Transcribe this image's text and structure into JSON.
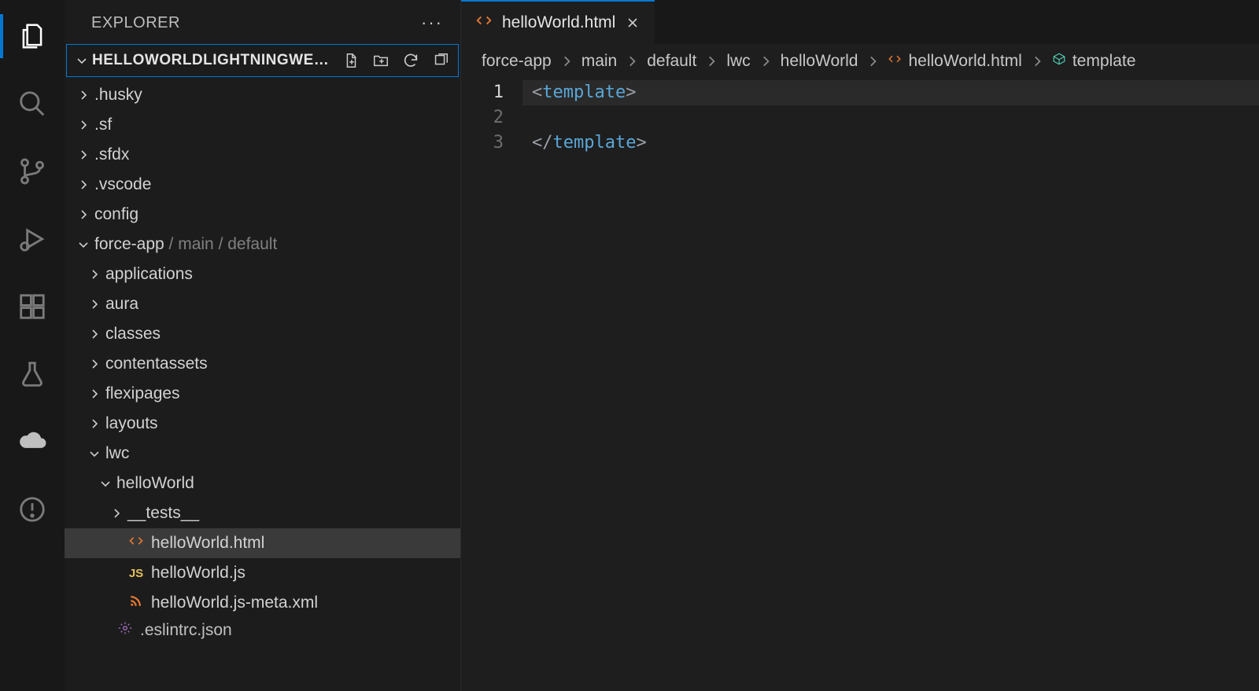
{
  "activity": {
    "items": [
      {
        "name": "explorer",
        "active": true
      },
      {
        "name": "search",
        "active": false
      },
      {
        "name": "source-control",
        "active": false
      },
      {
        "name": "run-debug",
        "active": false
      },
      {
        "name": "extensions",
        "active": false
      },
      {
        "name": "testing",
        "active": false
      },
      {
        "name": "salesforce",
        "active": false
      },
      {
        "name": "problems",
        "active": false
      }
    ]
  },
  "sidebar": {
    "title": "EXPLORER",
    "project": "HELLOWORLDLIGHTNINGWE…",
    "tree": [
      {
        "kind": "folder",
        "label": ".husky",
        "depth": 0,
        "open": false
      },
      {
        "kind": "folder",
        "label": ".sf",
        "depth": 0,
        "open": false
      },
      {
        "kind": "folder",
        "label": ".sfdx",
        "depth": 0,
        "open": false
      },
      {
        "kind": "folder",
        "label": ".vscode",
        "depth": 0,
        "open": false
      },
      {
        "kind": "folder",
        "label": "config",
        "depth": 0,
        "open": false
      },
      {
        "kind": "folder",
        "label": "force-app",
        "dim": " / main / default",
        "depth": 0,
        "open": true
      },
      {
        "kind": "folder",
        "label": "applications",
        "depth": 1,
        "open": false
      },
      {
        "kind": "folder",
        "label": "aura",
        "depth": 1,
        "open": false
      },
      {
        "kind": "folder",
        "label": "classes",
        "depth": 1,
        "open": false
      },
      {
        "kind": "folder",
        "label": "contentassets",
        "depth": 1,
        "open": false
      },
      {
        "kind": "folder",
        "label": "flexipages",
        "depth": 1,
        "open": false
      },
      {
        "kind": "folder",
        "label": "layouts",
        "depth": 1,
        "open": false
      },
      {
        "kind": "folder",
        "label": "lwc",
        "depth": 1,
        "open": true
      },
      {
        "kind": "folder",
        "label": "helloWorld",
        "depth": 2,
        "open": true
      },
      {
        "kind": "folder",
        "label": "__tests__",
        "depth": 3,
        "open": false
      },
      {
        "kind": "file",
        "label": "helloWorld.html",
        "depth": 3,
        "icon": "code-orange",
        "selected": true
      },
      {
        "kind": "file",
        "label": "helloWorld.js",
        "depth": 3,
        "icon": "js-yellow"
      },
      {
        "kind": "file",
        "label": "helloWorld.js-meta.xml",
        "depth": 3,
        "icon": "rss-orange"
      },
      {
        "kind": "file",
        "label": ".eslintrc.json",
        "depth": 2,
        "icon": "gear-purple",
        "cut": true
      }
    ]
  },
  "tab": {
    "filename": "helloWorld.html"
  },
  "breadcrumbs": [
    {
      "label": "force-app"
    },
    {
      "label": "main"
    },
    {
      "label": "default"
    },
    {
      "label": "lwc"
    },
    {
      "label": "helloWorld"
    },
    {
      "label": "helloWorld.html",
      "icon": "code-orange"
    },
    {
      "label": "template",
      "icon": "package-teal"
    }
  ],
  "code": {
    "lines": [
      {
        "n": 1,
        "tokens": [
          {
            "t": "<",
            "c": "punct"
          },
          {
            "t": "template",
            "c": "tag"
          },
          {
            "t": ">",
            "c": "punct"
          }
        ],
        "active": true
      },
      {
        "n": 2,
        "tokens": []
      },
      {
        "n": 3,
        "tokens": [
          {
            "t": "</",
            "c": "punct"
          },
          {
            "t": "template",
            "c": "tag"
          },
          {
            "t": ">",
            "c": "punct"
          }
        ]
      }
    ]
  }
}
